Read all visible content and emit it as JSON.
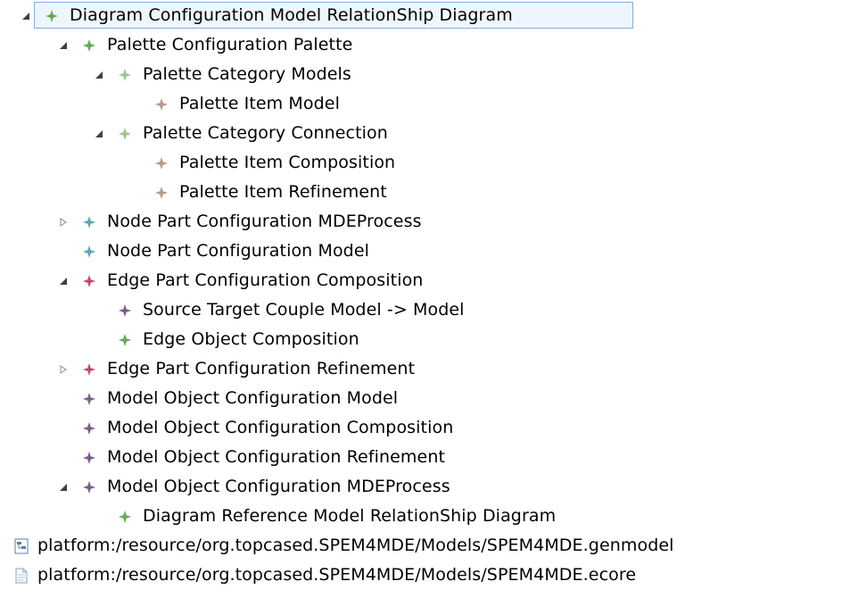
{
  "tree": {
    "colors": {
      "green": "#66a856",
      "light_green": "#9dc58b",
      "tan": "#b79a8c",
      "teal": "#5aa7b7",
      "pink": "#c2477a",
      "purple": "#7b5d8d",
      "selection_border": "#7fb0de",
      "selection_fill": "#eef5fc"
    },
    "rows": [
      {
        "label": "Diagram Configuration Model RelationShip Diagram",
        "depth": 0,
        "toggle": "expanded",
        "icon": "green",
        "selected": true
      },
      {
        "label": "Palette Configuration Palette",
        "depth": 1,
        "toggle": "expanded",
        "icon": "green"
      },
      {
        "label": "Palette Category Models",
        "depth": 2,
        "toggle": "expanded",
        "icon": "light_green"
      },
      {
        "label": "Palette Item Model",
        "depth": 3,
        "toggle": "none",
        "icon": "tan"
      },
      {
        "label": "Palette Category Connection",
        "depth": 2,
        "toggle": "expanded",
        "icon": "light_green"
      },
      {
        "label": "Palette Item Composition",
        "depth": 3,
        "toggle": "none",
        "icon": "tan"
      },
      {
        "label": "Palette Item Refinement",
        "depth": 3,
        "toggle": "none",
        "icon": "tan"
      },
      {
        "label": "Node Part Configuration MDEProcess",
        "depth": 1,
        "toggle": "collapsed",
        "icon": "teal"
      },
      {
        "label": "Node Part Configuration Model",
        "depth": 1,
        "toggle": "none",
        "icon": "teal"
      },
      {
        "label": "Edge Part Configuration Composition",
        "depth": 1,
        "toggle": "expanded",
        "icon": "pink"
      },
      {
        "label": "Source Target Couple Model -> Model",
        "depth": 2,
        "toggle": "none",
        "icon": "purple"
      },
      {
        "label": "Edge Object Composition",
        "depth": 2,
        "toggle": "none",
        "icon": "green"
      },
      {
        "label": "Edge Part Configuration Refinement",
        "depth": 1,
        "toggle": "collapsed",
        "icon": "pink"
      },
      {
        "label": "Model Object Configuration Model",
        "depth": 1,
        "toggle": "none",
        "icon": "purple"
      },
      {
        "label": "Model Object Configuration Composition",
        "depth": 1,
        "toggle": "none",
        "icon": "purple"
      },
      {
        "label": "Model Object Configuration Refinement",
        "depth": 1,
        "toggle": "none",
        "icon": "purple"
      },
      {
        "label": "Model Object Configuration MDEProcess",
        "depth": 1,
        "toggle": "expanded",
        "icon": "purple"
      },
      {
        "label": "Diagram Reference Model RelationShip Diagram",
        "depth": 2,
        "toggle": "none",
        "icon": "green"
      },
      {
        "label": "platform:/resource/org.topcased.SPEM4MDE/Models/SPEM4MDE.genmodel",
        "depth": -1,
        "toggle": "none",
        "icon": "genmodel-file-icon"
      },
      {
        "label": "platform:/resource/org.topcased.SPEM4MDE/Models/SPEM4MDE.ecore",
        "depth": -1,
        "toggle": "none",
        "icon": "ecore-file-icon"
      }
    ]
  }
}
